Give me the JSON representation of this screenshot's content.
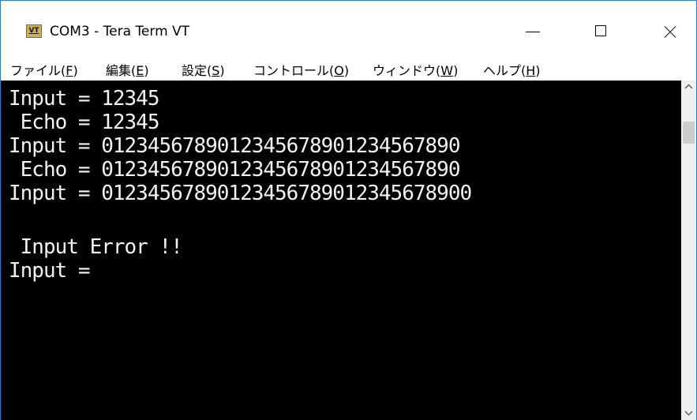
{
  "window": {
    "title": "COM3 - Tera Term VT",
    "icon_label": "VT",
    "icon": "tera-term-vt-icon"
  },
  "controls": {
    "minimize_icon": "minimize-icon",
    "maximize_icon": "maximize-icon",
    "close_icon": "close-icon"
  },
  "menu": {
    "items": [
      {
        "label": "ファイル(",
        "mnemonic": "F",
        "suffix": ")"
      },
      {
        "label": "編集(",
        "mnemonic": "E",
        "suffix": ")"
      },
      {
        "label": "設定(",
        "mnemonic": "S",
        "suffix": ")"
      },
      {
        "label": "コントロール(",
        "mnemonic": "O",
        "suffix": ")"
      },
      {
        "label": "ウィンドウ(",
        "mnemonic": "W",
        "suffix": ")"
      },
      {
        "label": "ヘルプ(",
        "mnemonic": "H",
        "suffix": ")"
      }
    ]
  },
  "terminal": {
    "background": "#000000",
    "foreground": "#f2f2f2",
    "lines": [
      "Input = 12345",
      " Echo = 12345",
      "Input = 0123456789012345678901234567890",
      " Echo = 0123456789012345678901234567890",
      "Input = 01234567890123456789012345678900",
      "",
      " Input Error !!",
      "Input ="
    ]
  },
  "scrollbar": {
    "up_icon": "scroll-up-arrow-icon",
    "down_icon": "scroll-down-arrow-icon"
  }
}
